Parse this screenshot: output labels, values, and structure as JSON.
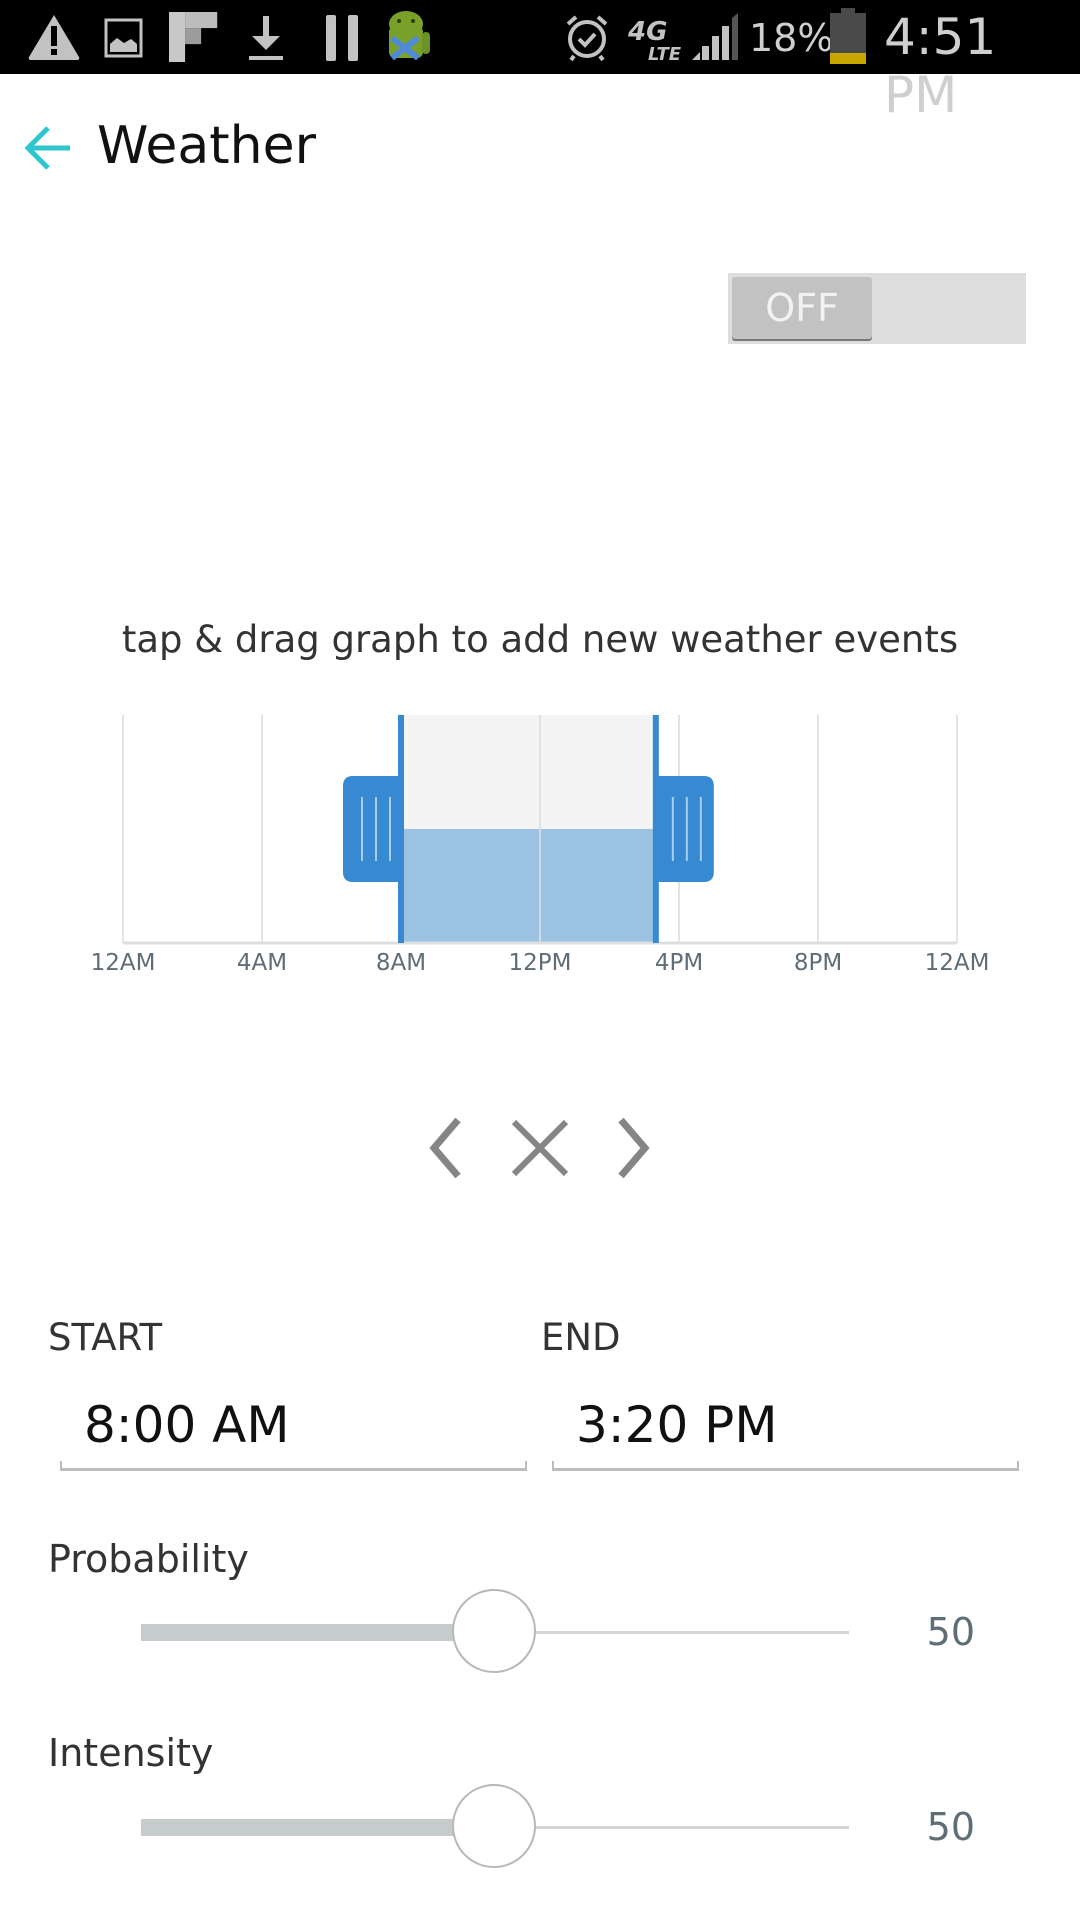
{
  "status_bar": {
    "left_icons": [
      "warning-icon",
      "image-icon",
      "flipboard-icon",
      "download-icon",
      "pause-icon",
      "android-debug-icon"
    ],
    "right_icons": [
      "alarm-icon",
      "4g-lte-icon",
      "signal-icon",
      "battery-icon"
    ],
    "battery": "18%",
    "time": "4:51 PM",
    "battery_color": "#c8a600"
  },
  "header": {
    "back_icon": "arrow-left-icon",
    "title": "Weather",
    "accent_color": "#2cc6cc"
  },
  "toggle": {
    "state": "OFF"
  },
  "hint": "tap & drag graph to add new weather events",
  "chart_data": {
    "type": "area",
    "title": "",
    "xlabel": "",
    "ylabel": "",
    "x_ticks": [
      "12AM",
      "4AM",
      "8AM",
      "12PM",
      "4PM",
      "8PM",
      "12AM"
    ],
    "x_range_hours": [
      0,
      24
    ],
    "grid": true,
    "events": [
      {
        "start_hour": 8.0,
        "end_hour": 15.333,
        "level": 0.5,
        "selected": true
      }
    ],
    "colors": {
      "selection": "#3789d1",
      "fill": "#9bc1e3",
      "background": "#f4f4f4"
    }
  },
  "nav": {
    "prev_icon": "chevron-left-icon",
    "delete_icon": "close-icon",
    "next_icon": "chevron-right-icon"
  },
  "form": {
    "start_label": "START",
    "start_value": "8:00 AM",
    "end_label": "END",
    "end_value": "3:20 PM"
  },
  "sliders": {
    "probability": {
      "label": "Probability",
      "value": "50",
      "fraction": 0.5
    },
    "intensity": {
      "label": "Intensity",
      "value": "50",
      "fraction": 0.5
    }
  }
}
